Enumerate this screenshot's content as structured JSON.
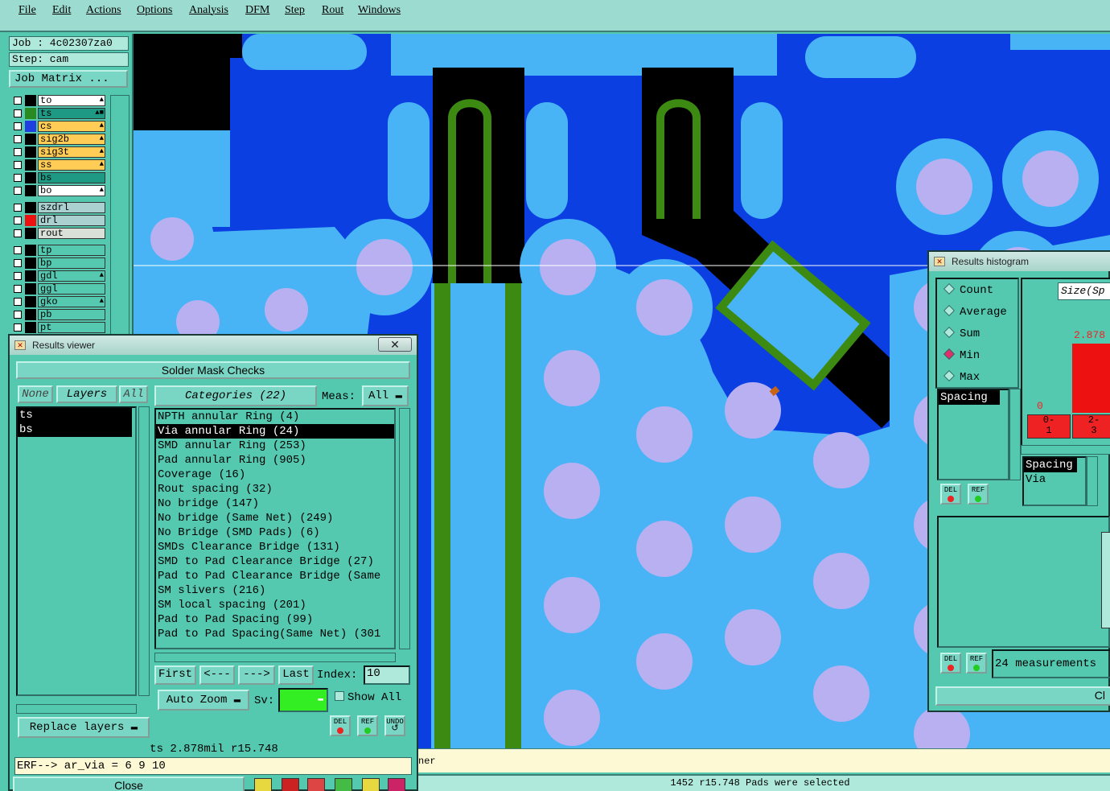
{
  "menu": [
    "File",
    "Edit",
    "Actions",
    "Options",
    "Analysis",
    "DFM",
    "Step",
    "Rout",
    "Windows"
  ],
  "left": {
    "job": "Job : 4c02307za0",
    "step": "Step: cam",
    "job_matrix": "Job Matrix ...",
    "layers": [
      {
        "name": "to",
        "color": "#000000",
        "bg": "#ffffff",
        "hand": "▲"
      },
      {
        "name": "ts",
        "color": "#2a8a22",
        "bg": "#1e9a84",
        "hand": "▲■"
      },
      {
        "name": "cs",
        "color": "#1f3fe0",
        "bg": "#ffcc55",
        "hand": "▲"
      },
      {
        "name": "sig2b",
        "color": "#000000",
        "bg": "#ffcc55",
        "hand": "▲"
      },
      {
        "name": "sig3t",
        "color": "#000000",
        "bg": "#ffcc55",
        "hand": "▲"
      },
      {
        "name": "ss",
        "color": "#000000",
        "bg": "#ffcc55",
        "hand": "▲"
      },
      {
        "name": "bs",
        "color": "#000000",
        "bg": "#1e9a84",
        "hand": ""
      },
      {
        "name": "bo",
        "color": "#000000",
        "bg": "#ffffff",
        "hand": "▲"
      },
      {
        "name": "szdrl",
        "color": "#000000",
        "bg": "#aad0d0",
        "hand": ""
      },
      {
        "name": "drl",
        "color": "#ee1111",
        "bg": "#aad0d0",
        "hand": ""
      },
      {
        "name": "rout",
        "color": "#000000",
        "bg": "#d8e0d8",
        "hand": ""
      },
      {
        "name": "tp",
        "color": "#000000",
        "bg": "#55c8b0",
        "hand": ""
      },
      {
        "name": "bp",
        "color": "#000000",
        "bg": "#55c8b0",
        "hand": ""
      },
      {
        "name": "gdl",
        "color": "#000000",
        "bg": "#55c8b0",
        "hand": "▲"
      },
      {
        "name": "ggl",
        "color": "#000000",
        "bg": "#55c8b0",
        "hand": ""
      },
      {
        "name": "gko",
        "color": "#000000",
        "bg": "#55c8b0",
        "hand": "▲"
      },
      {
        "name": "pb",
        "color": "#000000",
        "bg": "#55c8b0",
        "hand": ""
      },
      {
        "name": "pt",
        "color": "#000000",
        "bg": "#55c8b0",
        "hand": ""
      }
    ]
  },
  "viewer": {
    "title": "Results viewer",
    "close_x": "✕",
    "header": "Solder Mask Checks",
    "none": "None",
    "layers_label": "Layers",
    "all": "All",
    "layer_items": [
      "ts",
      "bs"
    ],
    "categories": "Categories (22)",
    "meas_label": "Meas:",
    "meas_value": "All",
    "checks": [
      "NPTH annular Ring (4)",
      "Via annular Ring (24)",
      "SMD annular Ring (253)",
      "Pad annular Ring (905)",
      "Coverage (16)",
      "Rout spacing (32)",
      "No bridge (147)",
      "No bridge (Same Net) (249)",
      "No Bridge (SMD Pads) (6)",
      "SMDs Clearance Bridge (131)",
      "SMD to Pad Clearance Bridge (27)",
      "Pad to Pad Clearance Bridge (Same",
      "SM slivers (216)",
      "SM local spacing (201)",
      "Pad to Pad Spacing (99)",
      "Pad to Pad Spacing(Same Net) (301"
    ],
    "first": "First",
    "prev": "<---",
    "next": "--->",
    "last": "Last",
    "index_label": "Index:",
    "index_value": "10",
    "auto_zoom": "Auto Zoom",
    "sv_label": "Sv:",
    "sv_color": "#33ee22",
    "show_all": "Show All",
    "replace_layers": "Replace layers",
    "del": "DEL",
    "ref": "REF",
    "undo": "UNDO",
    "info": "ts 2.878mil   r15.748",
    "erf": "ERF--> ar_via = 6 9 10",
    "close": "Close"
  },
  "hist": {
    "title": "Results histogram",
    "radios": [
      "Count",
      "Average",
      "Sum",
      "Min",
      "Max"
    ],
    "selected": "Min",
    "size_label": "Size(Sp",
    "max_value": "2.878",
    "zero": "0",
    "bin1": "0-\n1",
    "bin2": "2-\n3",
    "list1": [
      "Spacing"
    ],
    "list2": [
      "Spacing",
      "Via"
    ],
    "measurements": "24 measurements",
    "close_partial": "Cl",
    "del": "DEL",
    "ref": "REF",
    "bar_color": "#ee1111"
  },
  "status": {
    "line1": "ner",
    "line2": "1452 r15.748 Pads were selected"
  }
}
